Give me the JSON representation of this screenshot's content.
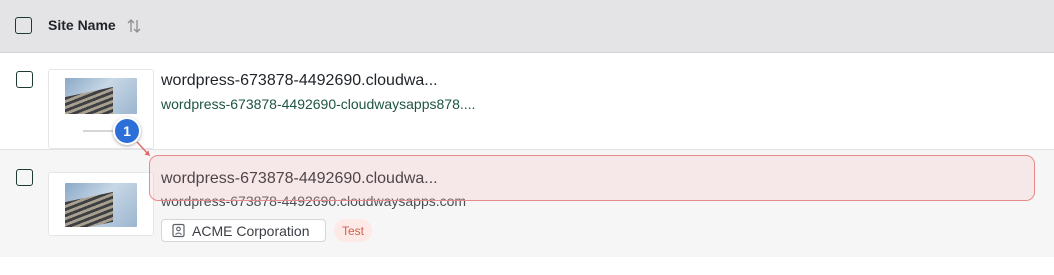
{
  "header": {
    "column_title": "Site Name"
  },
  "rows": [
    {
      "title": "wordpress-673878-4492690.cloudwa...",
      "url": "wordpress-673878-4492690-cloudwaysapps878...."
    },
    {
      "title": "wordpress-673878-4492690.cloudwa...",
      "url": "wordpress-673878-4492690.cloudwaysapps.com",
      "organization": "ACME Corporation",
      "tag": "Test"
    }
  ],
  "annotation": {
    "marker_number": "1",
    "highlight_color": "#e88a8a",
    "marker_color": "#2d6fd8"
  },
  "icons": {
    "sort": "sort-arrows-icon",
    "organization": "building-icon"
  }
}
